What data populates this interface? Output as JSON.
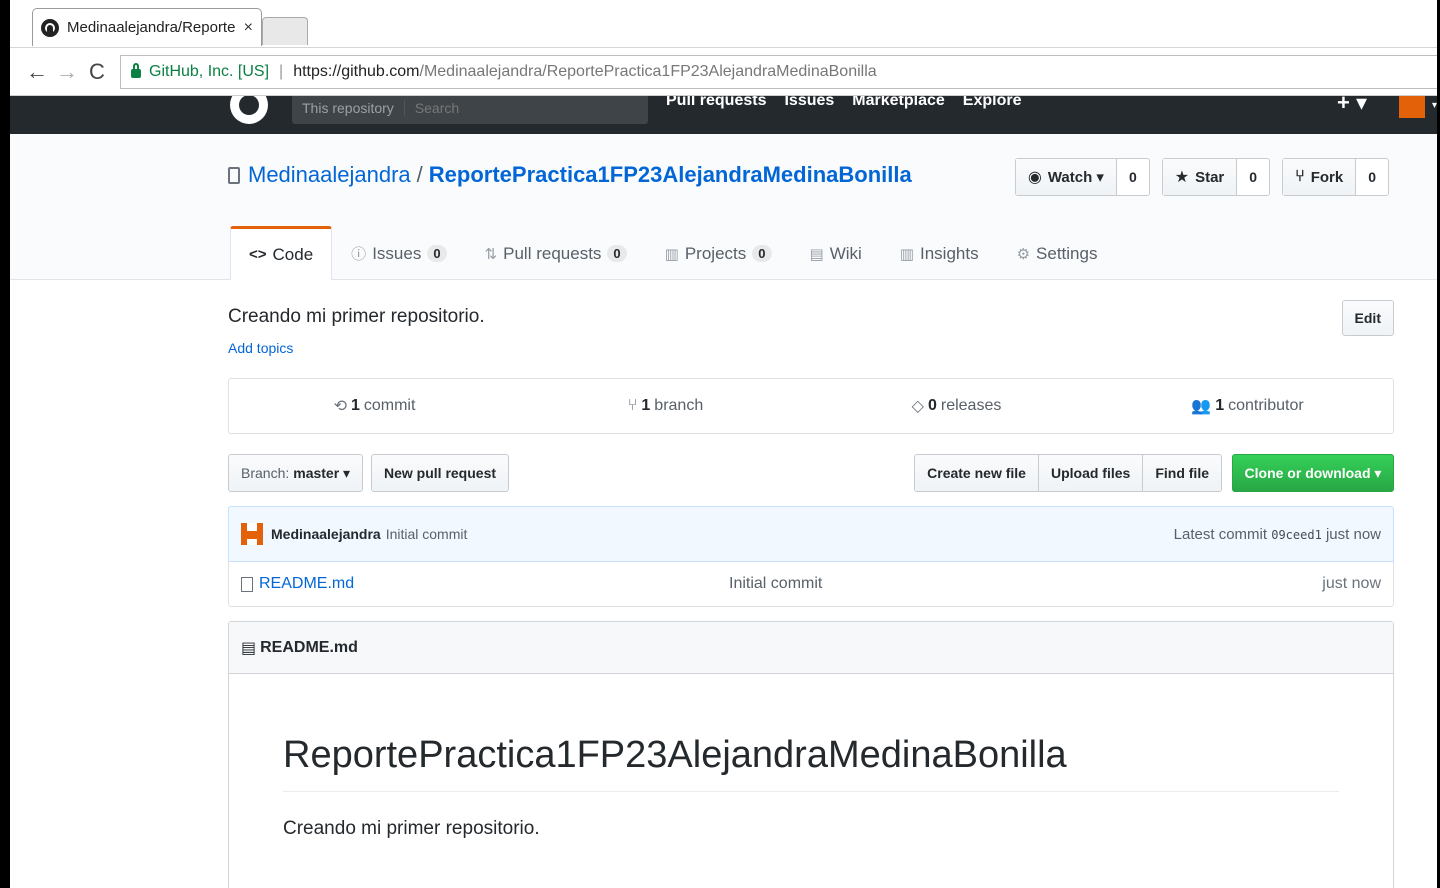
{
  "browser": {
    "tab_title": "Medinaalejandra/Reporte",
    "tab_close": "×",
    "back": "←",
    "forward": "→",
    "reload": "C",
    "cert_org": "GitHub, Inc. [US]",
    "url_host": "https://github.com",
    "url_path": "/Medinaalejandra/ReportePractica1FP23AlejandraMedinaBonilla"
  },
  "gh_header": {
    "search_scope": "This repository",
    "search_placeholder": "Search",
    "nav": [
      "Pull requests",
      "Issues",
      "Marketplace",
      "Explore"
    ],
    "plus": "+ ▾"
  },
  "repo": {
    "owner": "Medinaalejandra",
    "slash": "/",
    "name": "ReportePractica1FP23AlejandraMedinaBonilla",
    "watch_label": "Watch ▾",
    "watch_count": "0",
    "star_label": "Star",
    "star_count": "0",
    "fork_label": "Fork",
    "fork_count": "0"
  },
  "tabs": {
    "code": "Code",
    "issues": "Issues",
    "issues_count": "0",
    "pulls": "Pull requests",
    "pulls_count": "0",
    "projects": "Projects",
    "projects_count": "0",
    "wiki": "Wiki",
    "insights": "Insights",
    "settings": "Settings"
  },
  "summary": {
    "description": "Creando mi primer repositorio.",
    "add_topics": "Add topics",
    "edit": "Edit"
  },
  "numbers": {
    "commits_n": "1",
    "commits_label": "commit",
    "branches_n": "1",
    "branches_label": "branch",
    "releases_n": "0",
    "releases_label": "releases",
    "contributors_n": "1",
    "contributors_label": "contributor"
  },
  "filebar": {
    "branch_prefix": "Branch:",
    "branch_name": "master ▾",
    "new_pr": "New pull request",
    "create_file": "Create new file",
    "upload_files": "Upload files",
    "find_file": "Find file",
    "clone": "Clone or download ▾"
  },
  "commit": {
    "author": "Medinaalejandra",
    "message": "Initial commit",
    "latest_label": "Latest commit",
    "sha": "09ceed1",
    "age": "just now"
  },
  "files": [
    {
      "name": "README.md",
      "message": "Initial commit",
      "age": "just now"
    }
  ],
  "readme": {
    "header": "README.md",
    "h1": "ReportePractica1FP23AlejandraMedinaBonilla",
    "p": "Creando mi primer repositorio."
  },
  "colors": {
    "accent_orange": "#e36209",
    "link_blue": "#0366d6",
    "clone_green": "#28a745",
    "header_dark": "#24292e"
  }
}
